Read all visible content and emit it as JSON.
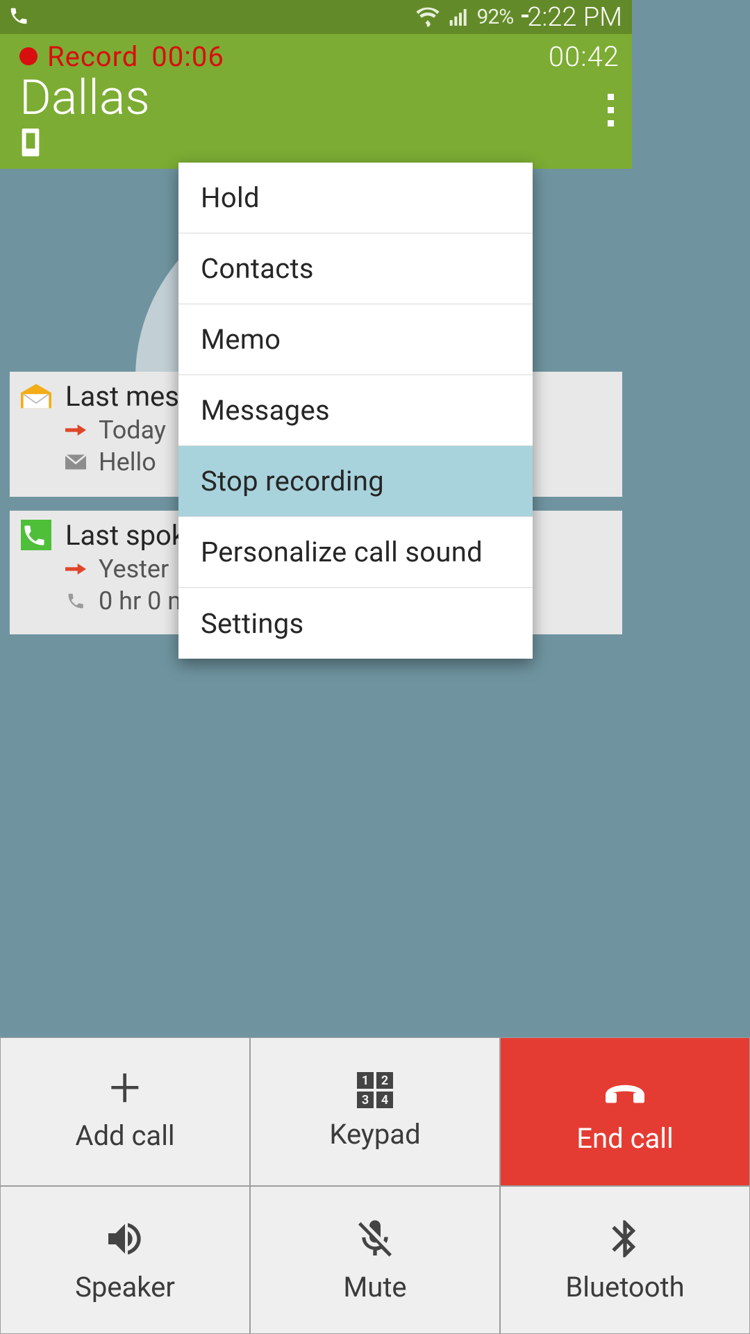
{
  "status": {
    "battery_pct": "92%",
    "time": "2:22 PM"
  },
  "header": {
    "record_label": "Record",
    "record_time": "00:06",
    "call_duration": "00:42",
    "contact_name": "Dallas"
  },
  "cards": {
    "last_message": {
      "title": "Last mes",
      "line1": "Today",
      "line2": "Hello"
    },
    "last_spoke": {
      "title": "Last spok",
      "line1": "Yester",
      "line2": "0 hr 0 m"
    }
  },
  "menu": {
    "items": [
      {
        "label": "Hold",
        "highlight": false
      },
      {
        "label": "Contacts",
        "highlight": false
      },
      {
        "label": "Memo",
        "highlight": false
      },
      {
        "label": "Messages",
        "highlight": false
      },
      {
        "label": "Stop recording",
        "highlight": true
      },
      {
        "label": "Personalize call sound",
        "highlight": false
      },
      {
        "label": "Settings",
        "highlight": false
      }
    ]
  },
  "buttons": {
    "add_call": "Add call",
    "keypad": "Keypad",
    "end_call": "End call",
    "speaker": "Speaker",
    "mute": "Mute",
    "bluetooth": "Bluetooth"
  },
  "keypad_cells": [
    "1",
    "2",
    "3",
    "4"
  ]
}
